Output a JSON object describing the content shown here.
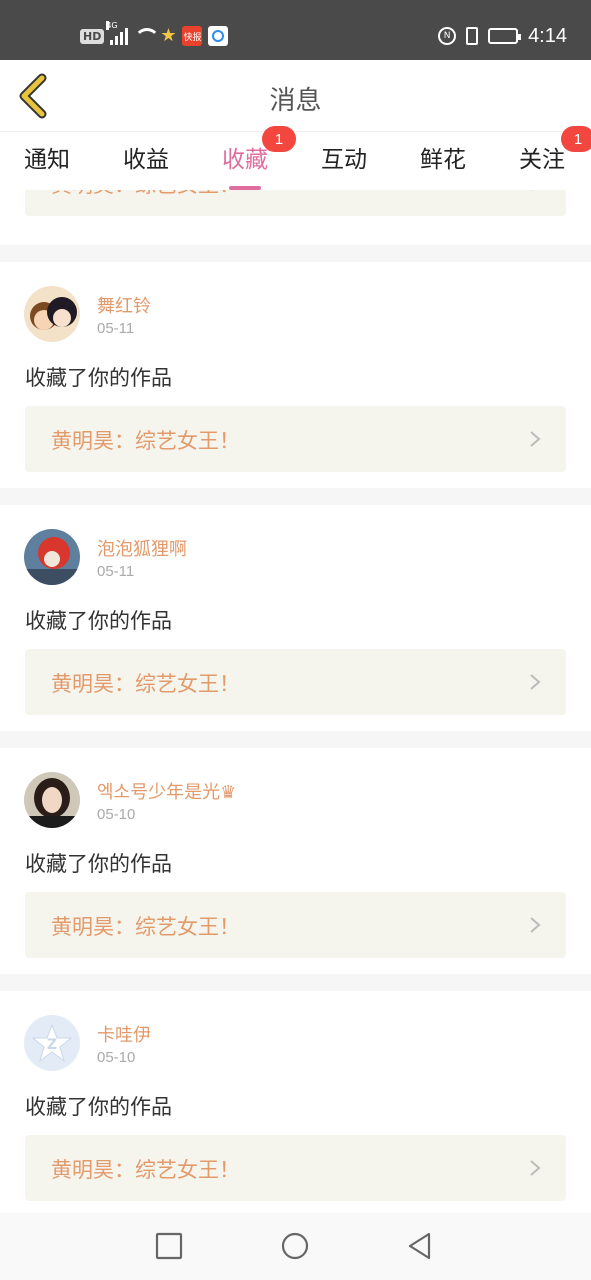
{
  "status_bar": {
    "hd": "HD",
    "network": "4G",
    "app_icon_1": "快报",
    "time": "4:14",
    "icons": [
      "hd-icon",
      "signal-icon",
      "wifi-icon",
      "star-app-icon",
      "news-app-icon",
      "browser-app-icon",
      "nfc-icon",
      "vibrate-icon",
      "battery-icon"
    ]
  },
  "header": {
    "title": "消息",
    "back_icon": "chevron-left-icon",
    "back_color": "#c9a227"
  },
  "tabs": [
    {
      "label": "通知",
      "active": false,
      "badge": ""
    },
    {
      "label": "收益",
      "active": false,
      "badge": ""
    },
    {
      "label": "收藏",
      "active": true,
      "badge": "1"
    },
    {
      "label": "互动",
      "active": false,
      "badge": ""
    },
    {
      "label": "鲜花",
      "active": false,
      "badge": ""
    },
    {
      "label": "关注",
      "active": false,
      "badge": "1"
    }
  ],
  "colors": {
    "accent": "#e06da0",
    "badge": "#f2463f",
    "username": "#e39a6b",
    "work_bg": "#f5f5ee"
  },
  "partial_card": {
    "work_title": "黄明昊：综艺女王！"
  },
  "cards": [
    {
      "username": "舞红铃",
      "date": "05-11",
      "action": "收藏了你的作品",
      "work_title": "黄明昊：综艺女王！",
      "avatar": "anime-girls-avatar"
    },
    {
      "username": "泡泡狐狸啊",
      "date": "05-11",
      "action": "收藏了你的作品",
      "work_title": "黄明昊：综艺女王！",
      "avatar": "red-fox-avatar"
    },
    {
      "username": "엑소号少年是光♛",
      "date": "05-10",
      "action": "收藏了你的作品",
      "work_title": "黄明昊：综艺女王！",
      "avatar": "girl-photo-avatar"
    },
    {
      "username": "卡哇伊",
      "date": "05-10",
      "action": "收藏了你的作品",
      "work_title": "黄明昊：综艺女王！",
      "avatar": "default-star-avatar"
    }
  ],
  "nav_bar": {
    "buttons": [
      "recent-apps-icon",
      "home-icon",
      "back-icon"
    ]
  }
}
